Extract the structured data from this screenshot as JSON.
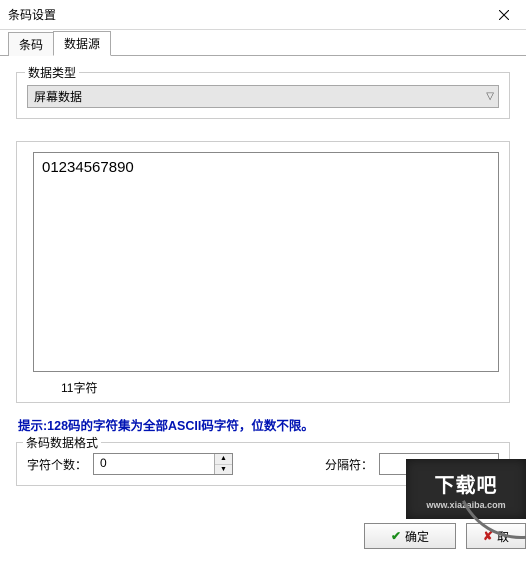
{
  "window": {
    "title": "条码设置"
  },
  "tabs": {
    "barcode": "条码",
    "datasource": "数据源"
  },
  "datatype": {
    "legend": "数据类型",
    "selected": "屏幕数据"
  },
  "textarea": {
    "value": "01234567890",
    "char_count": "11字符"
  },
  "hint": "提示:128码的字符集为全部ASCII码字符，位数不限。",
  "format": {
    "legend": "条码数据格式",
    "char_count_label": "字符个数：",
    "char_count_value": "0",
    "separator_label": "分隔符：",
    "separator_value": ""
  },
  "buttons": {
    "ok": "确定",
    "cancel": "取"
  },
  "watermark": {
    "big": "下载吧",
    "small": "www.xiazaiba.com"
  }
}
